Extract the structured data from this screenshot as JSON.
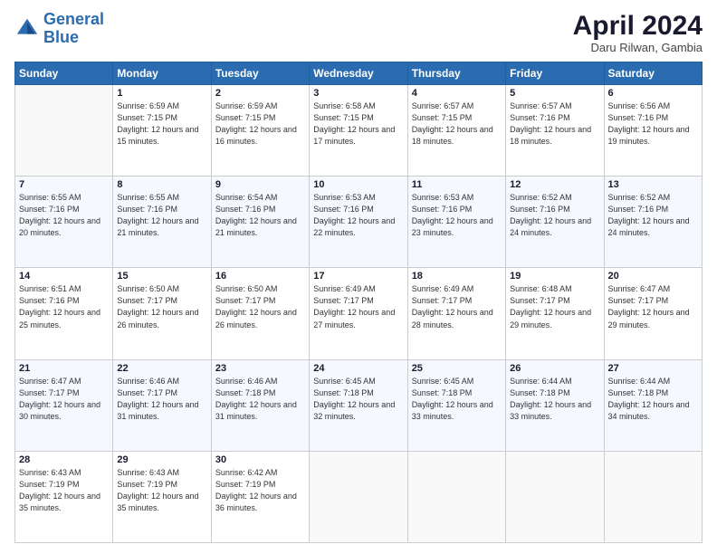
{
  "logo": {
    "line1": "General",
    "line2": "Blue"
  },
  "title": "April 2024",
  "subtitle": "Daru Rilwan, Gambia",
  "days_of_week": [
    "Sunday",
    "Monday",
    "Tuesday",
    "Wednesday",
    "Thursday",
    "Friday",
    "Saturday"
  ],
  "weeks": [
    [
      {
        "day": "",
        "empty": true
      },
      {
        "day": "1",
        "sunrise": "6:59 AM",
        "sunset": "7:15 PM",
        "daylight": "12 hours and 15 minutes."
      },
      {
        "day": "2",
        "sunrise": "6:59 AM",
        "sunset": "7:15 PM",
        "daylight": "12 hours and 16 minutes."
      },
      {
        "day": "3",
        "sunrise": "6:58 AM",
        "sunset": "7:15 PM",
        "daylight": "12 hours and 17 minutes."
      },
      {
        "day": "4",
        "sunrise": "6:57 AM",
        "sunset": "7:15 PM",
        "daylight": "12 hours and 18 minutes."
      },
      {
        "day": "5",
        "sunrise": "6:57 AM",
        "sunset": "7:16 PM",
        "daylight": "12 hours and 18 minutes."
      },
      {
        "day": "6",
        "sunrise": "6:56 AM",
        "sunset": "7:16 PM",
        "daylight": "12 hours and 19 minutes."
      }
    ],
    [
      {
        "day": "7",
        "sunrise": "6:55 AM",
        "sunset": "7:16 PM",
        "daylight": "12 hours and 20 minutes."
      },
      {
        "day": "8",
        "sunrise": "6:55 AM",
        "sunset": "7:16 PM",
        "daylight": "12 hours and 21 minutes."
      },
      {
        "day": "9",
        "sunrise": "6:54 AM",
        "sunset": "7:16 PM",
        "daylight": "12 hours and 21 minutes."
      },
      {
        "day": "10",
        "sunrise": "6:53 AM",
        "sunset": "7:16 PM",
        "daylight": "12 hours and 22 minutes."
      },
      {
        "day": "11",
        "sunrise": "6:53 AM",
        "sunset": "7:16 PM",
        "daylight": "12 hours and 23 minutes."
      },
      {
        "day": "12",
        "sunrise": "6:52 AM",
        "sunset": "7:16 PM",
        "daylight": "12 hours and 24 minutes."
      },
      {
        "day": "13",
        "sunrise": "6:52 AM",
        "sunset": "7:16 PM",
        "daylight": "12 hours and 24 minutes."
      }
    ],
    [
      {
        "day": "14",
        "sunrise": "6:51 AM",
        "sunset": "7:16 PM",
        "daylight": "12 hours and 25 minutes."
      },
      {
        "day": "15",
        "sunrise": "6:50 AM",
        "sunset": "7:17 PM",
        "daylight": "12 hours and 26 minutes."
      },
      {
        "day": "16",
        "sunrise": "6:50 AM",
        "sunset": "7:17 PM",
        "daylight": "12 hours and 26 minutes."
      },
      {
        "day": "17",
        "sunrise": "6:49 AM",
        "sunset": "7:17 PM",
        "daylight": "12 hours and 27 minutes."
      },
      {
        "day": "18",
        "sunrise": "6:49 AM",
        "sunset": "7:17 PM",
        "daylight": "12 hours and 28 minutes."
      },
      {
        "day": "19",
        "sunrise": "6:48 AM",
        "sunset": "7:17 PM",
        "daylight": "12 hours and 29 minutes."
      },
      {
        "day": "20",
        "sunrise": "6:47 AM",
        "sunset": "7:17 PM",
        "daylight": "12 hours and 29 minutes."
      }
    ],
    [
      {
        "day": "21",
        "sunrise": "6:47 AM",
        "sunset": "7:17 PM",
        "daylight": "12 hours and 30 minutes."
      },
      {
        "day": "22",
        "sunrise": "6:46 AM",
        "sunset": "7:17 PM",
        "daylight": "12 hours and 31 minutes."
      },
      {
        "day": "23",
        "sunrise": "6:46 AM",
        "sunset": "7:18 PM",
        "daylight": "12 hours and 31 minutes."
      },
      {
        "day": "24",
        "sunrise": "6:45 AM",
        "sunset": "7:18 PM",
        "daylight": "12 hours and 32 minutes."
      },
      {
        "day": "25",
        "sunrise": "6:45 AM",
        "sunset": "7:18 PM",
        "daylight": "12 hours and 33 minutes."
      },
      {
        "day": "26",
        "sunrise": "6:44 AM",
        "sunset": "7:18 PM",
        "daylight": "12 hours and 33 minutes."
      },
      {
        "day": "27",
        "sunrise": "6:44 AM",
        "sunset": "7:18 PM",
        "daylight": "12 hours and 34 minutes."
      }
    ],
    [
      {
        "day": "28",
        "sunrise": "6:43 AM",
        "sunset": "7:19 PM",
        "daylight": "12 hours and 35 minutes."
      },
      {
        "day": "29",
        "sunrise": "6:43 AM",
        "sunset": "7:19 PM",
        "daylight": "12 hours and 35 minutes."
      },
      {
        "day": "30",
        "sunrise": "6:42 AM",
        "sunset": "7:19 PM",
        "daylight": "12 hours and 36 minutes."
      },
      {
        "day": "",
        "empty": true
      },
      {
        "day": "",
        "empty": true
      },
      {
        "day": "",
        "empty": true
      },
      {
        "day": "",
        "empty": true
      }
    ]
  ]
}
